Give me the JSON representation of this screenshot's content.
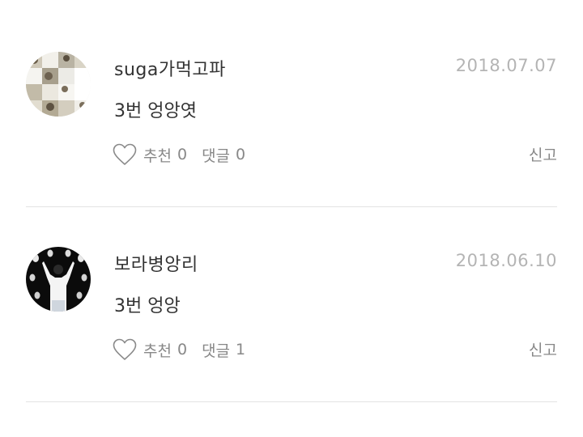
{
  "comments": [
    {
      "nickname": "suga가먹고파",
      "date": "2018.07.07",
      "content": "3번 엉앙엿",
      "like_label": "추천",
      "like_count": "0",
      "reply_label": "댓글",
      "reply_count": "0",
      "report_label": "신고"
    },
    {
      "nickname": "보라병앙리",
      "date": "2018.06.10",
      "content": "3번 엉앙",
      "like_label": "추천",
      "like_count": "0",
      "reply_label": "댓글",
      "reply_count": "1",
      "report_label": "신고"
    }
  ],
  "icons": {
    "like": "heart-outline-icon"
  },
  "colors": {
    "text": "#333333",
    "muted": "#888888",
    "date": "#b4b4b4",
    "divider": "#e3e3e3"
  }
}
